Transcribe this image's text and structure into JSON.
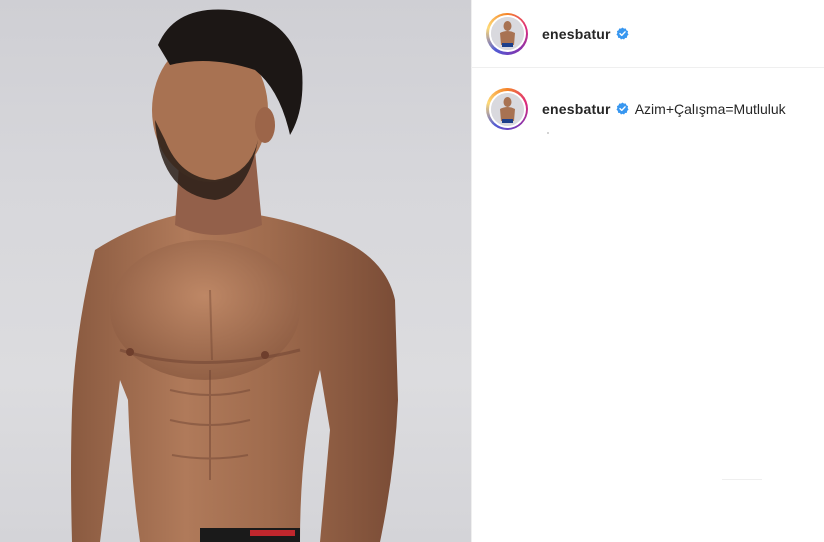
{
  "post": {
    "author": {
      "username": "enesbatur",
      "verified_icon": "verified-badge-icon",
      "verified_color": "#3897f0"
    },
    "caption": {
      "username": "enesbatur",
      "text": "Azim+Çalışma=Mutluluk"
    },
    "photo_icon": "profile-photo"
  },
  "colors": {
    "text": "#262626",
    "border": "#efefef",
    "story_ring": [
      "#f58529",
      "#dd2a7b",
      "#8134af",
      "#515bd4"
    ]
  }
}
